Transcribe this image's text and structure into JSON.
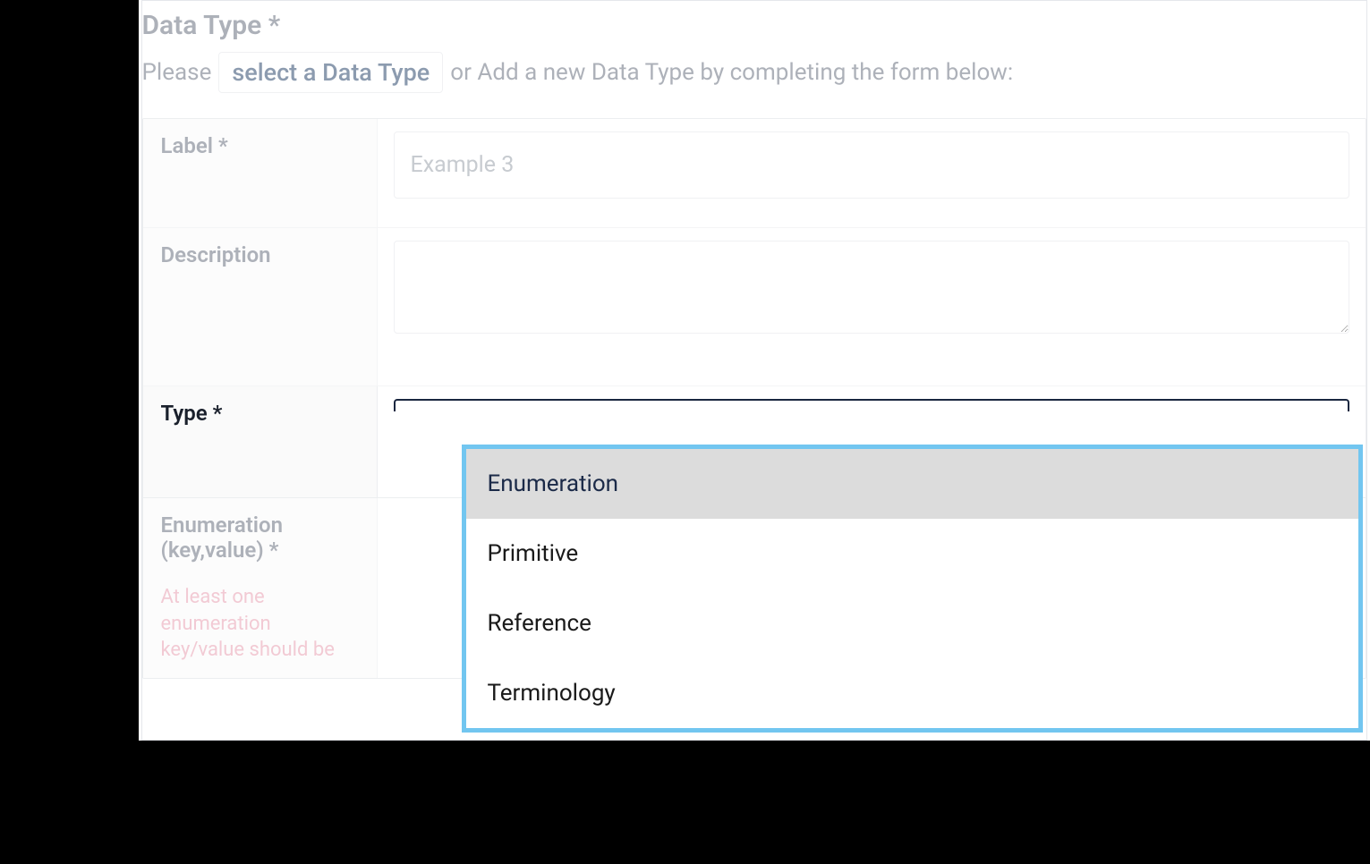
{
  "header": {
    "title": "Data Type *",
    "please": "Please",
    "select_btn": "select a Data Type",
    "after_text": "or Add a new Data Type by completing the form below:"
  },
  "rows": {
    "label": {
      "label": "Label *",
      "value": "Example 3"
    },
    "description": {
      "label": "Description",
      "value": ""
    },
    "type": {
      "label": "Type *"
    },
    "enumeration": {
      "label": "Enumeration (key,value) *",
      "hint": "At least one enumeration key/value should be"
    }
  },
  "dropdown": {
    "options": [
      "Enumeration",
      "Primitive",
      "Reference",
      "Terminology"
    ],
    "selected": "Enumeration"
  }
}
